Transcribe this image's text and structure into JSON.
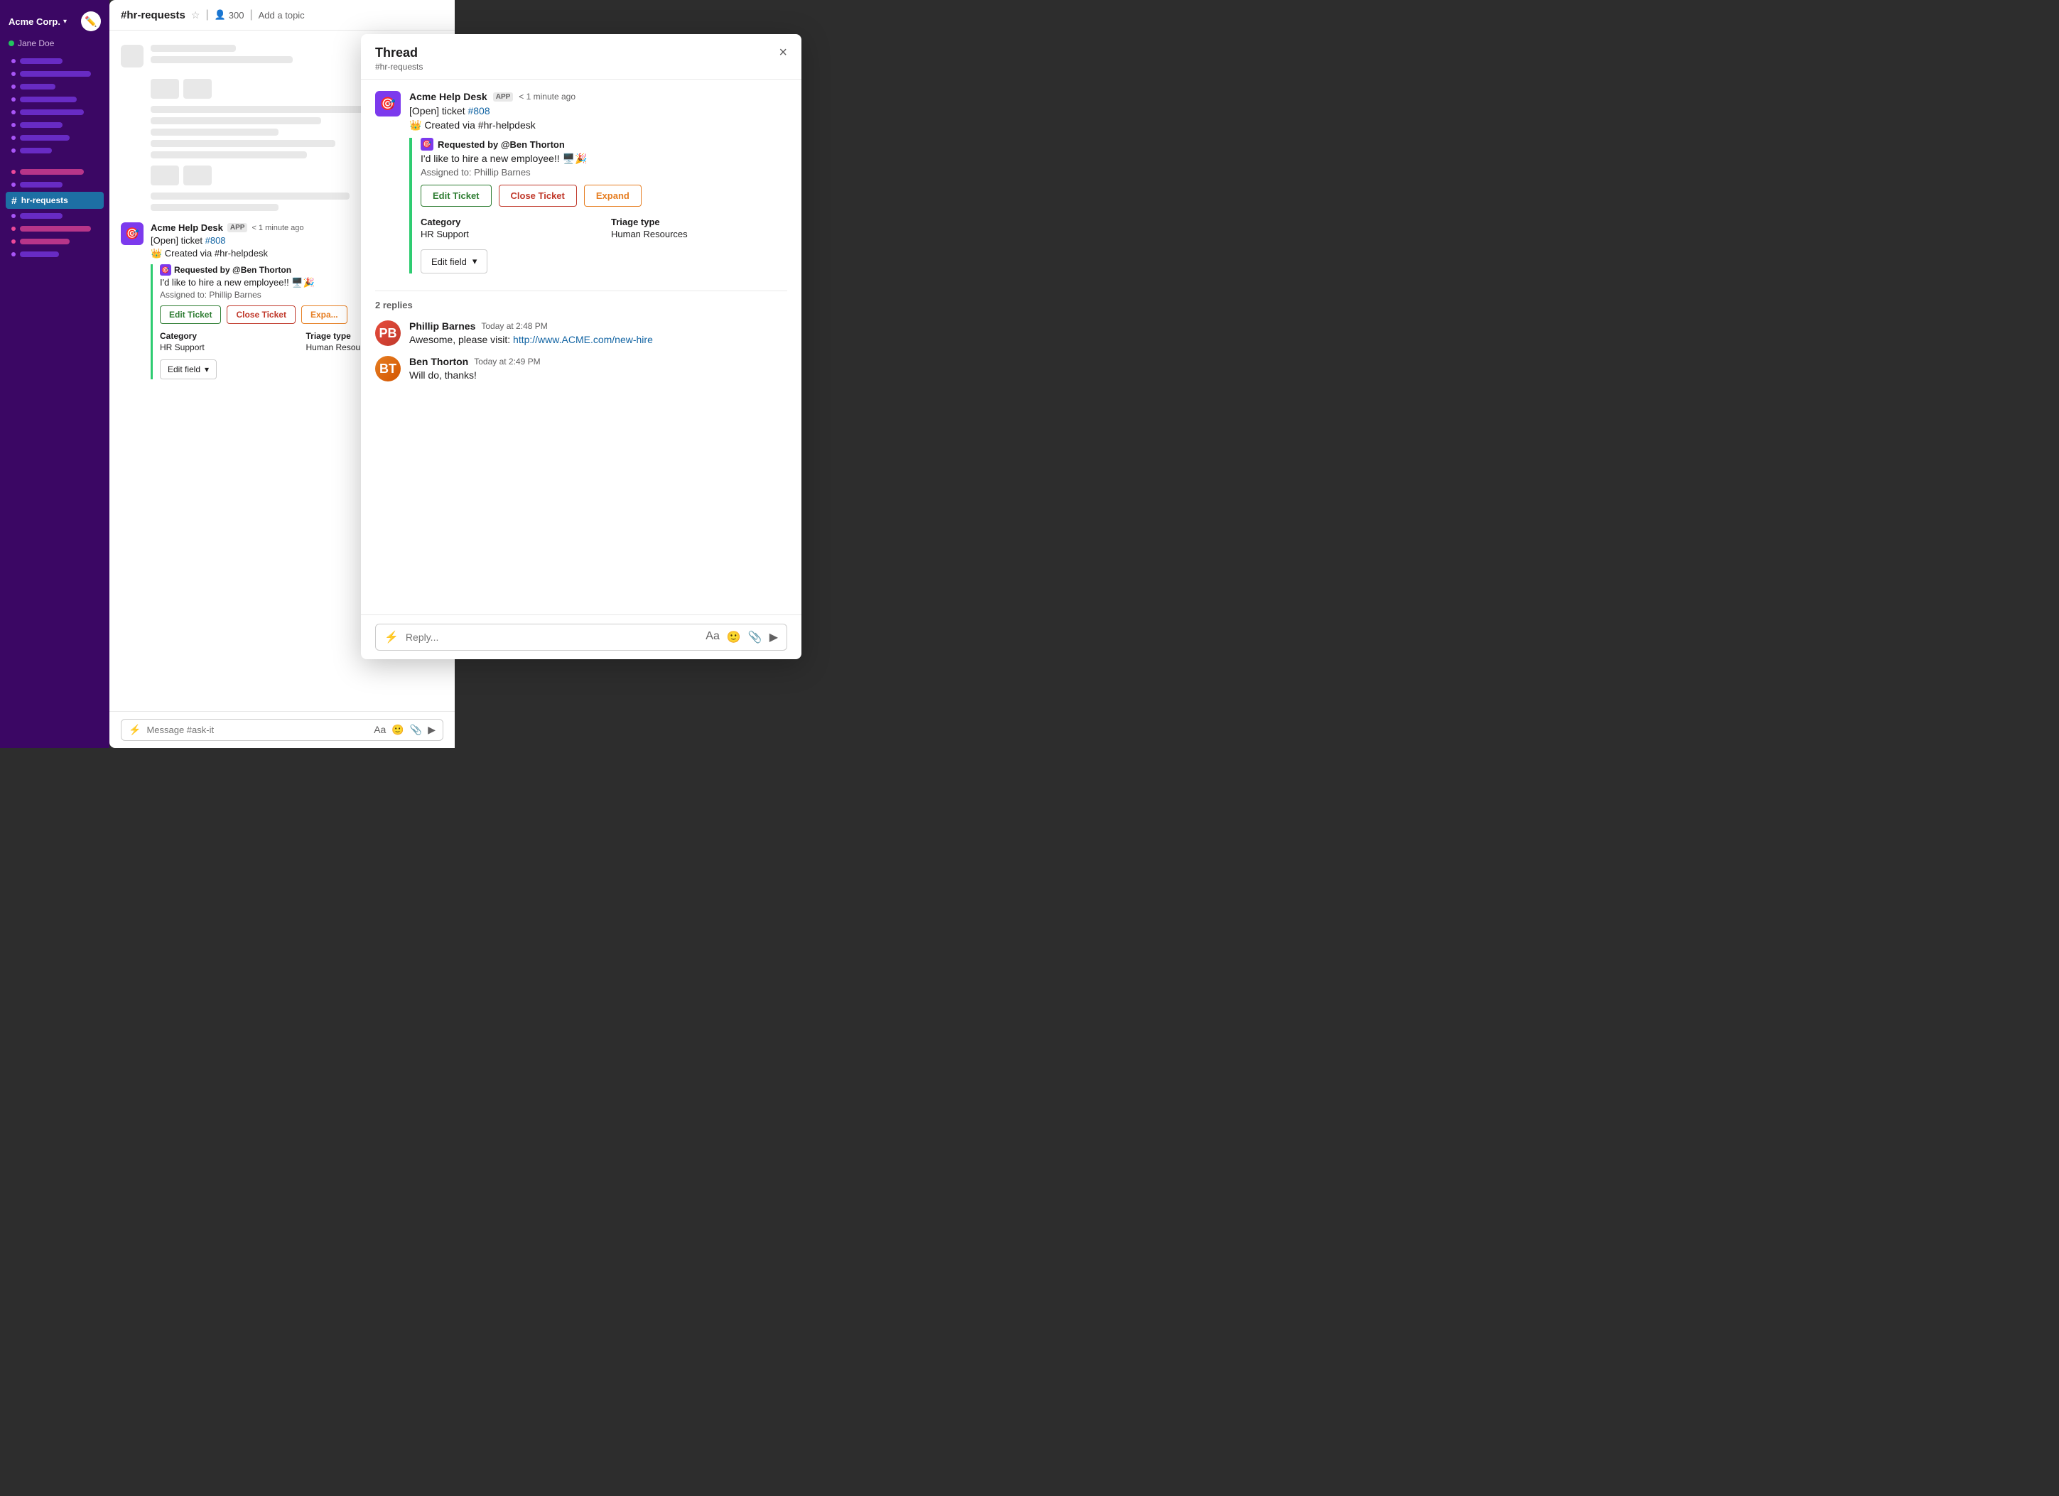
{
  "sidebar": {
    "workspace": "Acme Corp.",
    "user": "Jane Doe",
    "active_channel": "hr-requests",
    "items": [
      {
        "id": "item1",
        "width": 60,
        "dot_color": "#a855f7"
      },
      {
        "id": "item2",
        "width": 100,
        "dot_color": "#a855f7"
      },
      {
        "id": "item3",
        "width": 50,
        "dot_color": "#a855f7"
      },
      {
        "id": "item4",
        "width": 80,
        "dot_color": "#a855f7"
      },
      {
        "id": "item5",
        "width": 90,
        "dot_color": "#a855f7"
      },
      {
        "id": "item6",
        "width": 60,
        "dot_color": "#a855f7"
      },
      {
        "id": "item7",
        "width": 70,
        "dot_color": "#a855f7"
      },
      {
        "id": "item8",
        "width": 45,
        "dot_color": "#a855f7"
      }
    ],
    "bottom_items": [
      {
        "id": "bi1",
        "width": 90,
        "dot_color": "#ec4899"
      },
      {
        "id": "bi2",
        "width": 60,
        "dot_color": "#a855f7"
      },
      {
        "id": "bi3",
        "width": 100,
        "dot_color": "#a855f7"
      },
      {
        "id": "bi4",
        "width": 70,
        "dot_color": "#ec4899"
      }
    ]
  },
  "channel": {
    "name": "#hr-requests",
    "members": "300",
    "add_topic": "Add a topic",
    "message_placeholder": "Message #ask-it"
  },
  "message": {
    "sender": "Acme Help Desk",
    "app_badge": "APP",
    "time": "< 1 minute ago",
    "open_ticket": "[Open] ticket",
    "ticket_number": "#808",
    "created_via": "👑 Created via #hr-helpdesk",
    "requested_by": "Requested by @Ben Thorton",
    "message_text": "I'd like to hire a new employee!! 🖥️🎉",
    "assigned_to": "Assigned to: Phillip Barnes",
    "category_label": "Category",
    "category_value": "HR Support",
    "triage_label": "Triage type",
    "triage_value": "Human Resources",
    "edit_ticket_label": "Edit Ticket",
    "close_ticket_label": "Close Ticket",
    "expand_label": "Expa...",
    "edit_field_label": "Edit field"
  },
  "thread": {
    "title": "Thread",
    "subtitle": "#hr-requests",
    "close_btn": "×",
    "message": {
      "sender": "Acme Help Desk",
      "app_badge": "APP",
      "time": "< 1 minute ago",
      "open_ticket": "[Open] ticket",
      "ticket_number": "#808",
      "created_via": "👑 Created via #hr-helpdesk",
      "requested_by": "Requested by @Ben Thorton",
      "message_text": "I'd like to hire a new employee!! 🖥️🎉",
      "assigned_to": "Assigned to: Phillip Barnes",
      "edit_ticket_label": "Edit Ticket",
      "close_ticket_label": "Close Ticket",
      "expand_label": "Expand",
      "category_label": "Category",
      "category_value": "HR Support",
      "triage_label": "Triage type",
      "triage_value": "Human Resources",
      "edit_field_label": "Edit field"
    },
    "replies_count": "2 replies",
    "replies": [
      {
        "id": "reply1",
        "sender": "Phillip Barnes",
        "initials": "PB",
        "time": "Today at 2:48 PM",
        "text_prefix": "Awesome, please visit: ",
        "link": "http://www.ACME.com/new-hire",
        "text_suffix": ""
      },
      {
        "id": "reply2",
        "sender": "Ben Thorton",
        "initials": "BT",
        "time": "Today at 2:49 PM",
        "text": "Will do, thanks!",
        "link": ""
      }
    ],
    "reply_placeholder": "Reply..."
  }
}
